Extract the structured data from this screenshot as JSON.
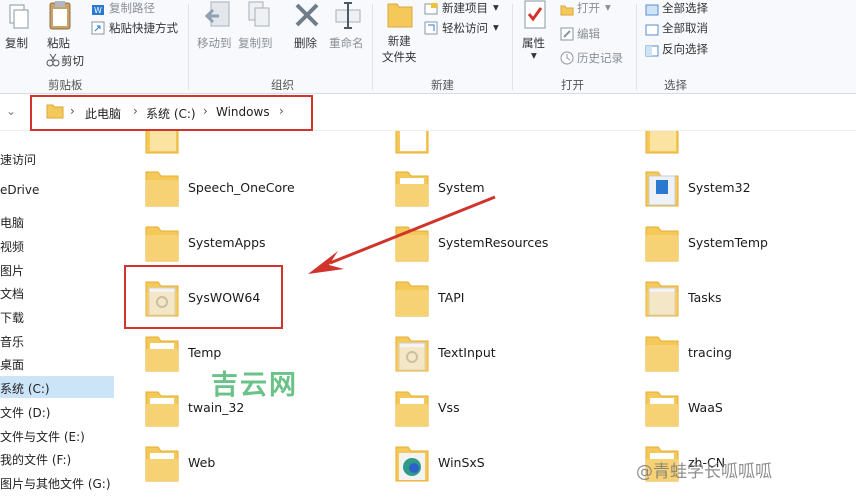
{
  "ribbon": {
    "clipboard": {
      "copy": "复制",
      "paste": "粘贴",
      "copy_path": "复制路径",
      "paste_shortcut": "粘贴快捷方式",
      "cut": "剪切",
      "group_label": "剪贴板"
    },
    "organize": {
      "move_to": "移动到",
      "copy_to": "复制到",
      "delete": "删除",
      "rename": "重命名",
      "group_label": "组织"
    },
    "new": {
      "new_folder": "新建\n文件夹",
      "new_item": "新建项目",
      "easy_access": "轻松访问",
      "group_label": "新建"
    },
    "open": {
      "properties": "属性",
      "open": "打开",
      "edit": "编辑",
      "history": "历史记录",
      "group_label": "打开"
    },
    "select": {
      "select_all": "全部选择",
      "select_none": "全部取消",
      "invert": "反向选择",
      "group_label": "选择"
    }
  },
  "address": {
    "crumbs": [
      "此电脑",
      "系统 (C:)",
      "Windows"
    ]
  },
  "nav": {
    "items": [
      "速访问",
      "eDrive",
      "电脑",
      "视频",
      "图片",
      "文档",
      "下载",
      "音乐",
      "桌面",
      "系统 (C:)",
      "文件 (D:)",
      "文件与文件 (E:)",
      "我的文件 (F:)",
      "图片与其他文件 (G:)"
    ],
    "selected_index": 9
  },
  "files": {
    "col1": [
      "Speech_OneCore",
      "SystemApps",
      "SysWOW64",
      "Temp",
      "twain_32",
      "Web"
    ],
    "col2": [
      "System",
      "SystemResources",
      "TAPI",
      "TextInput",
      "Vss",
      "WinSxS"
    ],
    "col3": [
      "System32",
      "SystemTemp",
      "Tasks",
      "tracing",
      "WaaS",
      "zh-CN"
    ]
  },
  "overlay": {
    "watermark": "吉云网",
    "credit": "@青蛙学长呱呱呱"
  },
  "colors": {
    "folder": "#f5c85a",
    "folder_dark": "#e6ad2e",
    "annotation_red": "#d0342c",
    "selection": "#cce4f7"
  }
}
